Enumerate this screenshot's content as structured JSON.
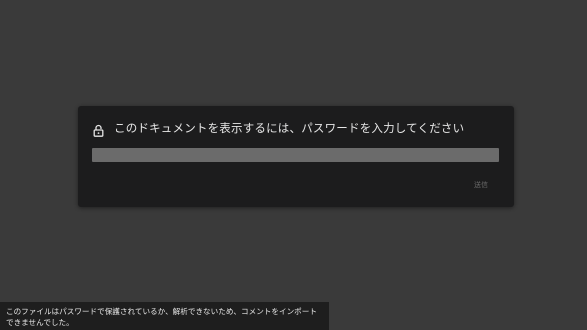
{
  "dialog": {
    "icon": "lock-icon",
    "title": "このドキュメントを表示するには、パスワードを入力してください",
    "password_value": "",
    "submit_label": "送信"
  },
  "toast": {
    "message": "このファイルはパスワードで保護されているか、解析できないため、コメントをインポートできませんでした。"
  },
  "colors": {
    "background": "#3a3a3a",
    "dialog_background": "#1c1c1d",
    "input_background": "#6b6b6b",
    "toast_background": "#1e1e1e"
  }
}
